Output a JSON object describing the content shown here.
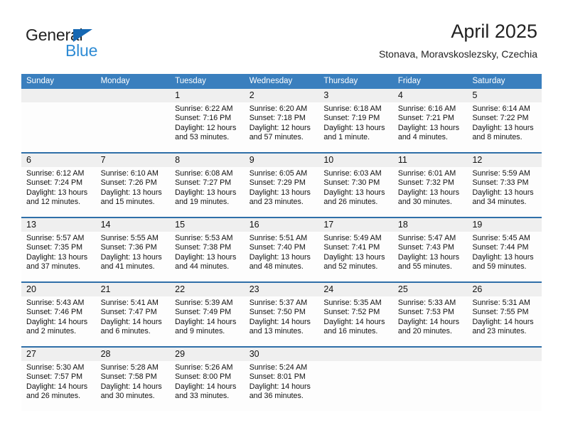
{
  "logo": {
    "word_one": "General",
    "word_two": "Blue",
    "triangle_icon": "triangle-icon",
    "brand_blue": "#2e8bd4",
    "triangle_blue": "#1668b3"
  },
  "header": {
    "title": "April 2025",
    "subtitle": "Stonava, Moravskoslezsky, Czechia"
  },
  "calendar": {
    "header_bg": "#3a7fbe",
    "row_rule": "#2f6fa8",
    "date_band_bg": "#efefef",
    "weekdays": [
      "Sunday",
      "Monday",
      "Tuesday",
      "Wednesday",
      "Thursday",
      "Friday",
      "Saturday"
    ],
    "labels": {
      "sunrise": "Sunrise:",
      "sunset": "Sunset:",
      "daylight": "Daylight:"
    },
    "weeks": [
      [
        {
          "day": "",
          "sunrise": "",
          "sunset": "",
          "daylight": ""
        },
        {
          "day": "",
          "sunrise": "",
          "sunset": "",
          "daylight": ""
        },
        {
          "day": "1",
          "sunrise": "Sunrise: 6:22 AM",
          "sunset": "Sunset: 7:16 PM",
          "daylight": "Daylight: 12 hours and 53 minutes."
        },
        {
          "day": "2",
          "sunrise": "Sunrise: 6:20 AM",
          "sunset": "Sunset: 7:18 PM",
          "daylight": "Daylight: 12 hours and 57 minutes."
        },
        {
          "day": "3",
          "sunrise": "Sunrise: 6:18 AM",
          "sunset": "Sunset: 7:19 PM",
          "daylight": "Daylight: 13 hours and 1 minute."
        },
        {
          "day": "4",
          "sunrise": "Sunrise: 6:16 AM",
          "sunset": "Sunset: 7:21 PM",
          "daylight": "Daylight: 13 hours and 4 minutes."
        },
        {
          "day": "5",
          "sunrise": "Sunrise: 6:14 AM",
          "sunset": "Sunset: 7:22 PM",
          "daylight": "Daylight: 13 hours and 8 minutes."
        }
      ],
      [
        {
          "day": "6",
          "sunrise": "Sunrise: 6:12 AM",
          "sunset": "Sunset: 7:24 PM",
          "daylight": "Daylight: 13 hours and 12 minutes."
        },
        {
          "day": "7",
          "sunrise": "Sunrise: 6:10 AM",
          "sunset": "Sunset: 7:26 PM",
          "daylight": "Daylight: 13 hours and 15 minutes."
        },
        {
          "day": "8",
          "sunrise": "Sunrise: 6:08 AM",
          "sunset": "Sunset: 7:27 PM",
          "daylight": "Daylight: 13 hours and 19 minutes."
        },
        {
          "day": "9",
          "sunrise": "Sunrise: 6:05 AM",
          "sunset": "Sunset: 7:29 PM",
          "daylight": "Daylight: 13 hours and 23 minutes."
        },
        {
          "day": "10",
          "sunrise": "Sunrise: 6:03 AM",
          "sunset": "Sunset: 7:30 PM",
          "daylight": "Daylight: 13 hours and 26 minutes."
        },
        {
          "day": "11",
          "sunrise": "Sunrise: 6:01 AM",
          "sunset": "Sunset: 7:32 PM",
          "daylight": "Daylight: 13 hours and 30 minutes."
        },
        {
          "day": "12",
          "sunrise": "Sunrise: 5:59 AM",
          "sunset": "Sunset: 7:33 PM",
          "daylight": "Daylight: 13 hours and 34 minutes."
        }
      ],
      [
        {
          "day": "13",
          "sunrise": "Sunrise: 5:57 AM",
          "sunset": "Sunset: 7:35 PM",
          "daylight": "Daylight: 13 hours and 37 minutes."
        },
        {
          "day": "14",
          "sunrise": "Sunrise: 5:55 AM",
          "sunset": "Sunset: 7:36 PM",
          "daylight": "Daylight: 13 hours and 41 minutes."
        },
        {
          "day": "15",
          "sunrise": "Sunrise: 5:53 AM",
          "sunset": "Sunset: 7:38 PM",
          "daylight": "Daylight: 13 hours and 44 minutes."
        },
        {
          "day": "16",
          "sunrise": "Sunrise: 5:51 AM",
          "sunset": "Sunset: 7:40 PM",
          "daylight": "Daylight: 13 hours and 48 minutes."
        },
        {
          "day": "17",
          "sunrise": "Sunrise: 5:49 AM",
          "sunset": "Sunset: 7:41 PM",
          "daylight": "Daylight: 13 hours and 52 minutes."
        },
        {
          "day": "18",
          "sunrise": "Sunrise: 5:47 AM",
          "sunset": "Sunset: 7:43 PM",
          "daylight": "Daylight: 13 hours and 55 minutes."
        },
        {
          "day": "19",
          "sunrise": "Sunrise: 5:45 AM",
          "sunset": "Sunset: 7:44 PM",
          "daylight": "Daylight: 13 hours and 59 minutes."
        }
      ],
      [
        {
          "day": "20",
          "sunrise": "Sunrise: 5:43 AM",
          "sunset": "Sunset: 7:46 PM",
          "daylight": "Daylight: 14 hours and 2 minutes."
        },
        {
          "day": "21",
          "sunrise": "Sunrise: 5:41 AM",
          "sunset": "Sunset: 7:47 PM",
          "daylight": "Daylight: 14 hours and 6 minutes."
        },
        {
          "day": "22",
          "sunrise": "Sunrise: 5:39 AM",
          "sunset": "Sunset: 7:49 PM",
          "daylight": "Daylight: 14 hours and 9 minutes."
        },
        {
          "day": "23",
          "sunrise": "Sunrise: 5:37 AM",
          "sunset": "Sunset: 7:50 PM",
          "daylight": "Daylight: 14 hours and 13 minutes."
        },
        {
          "day": "24",
          "sunrise": "Sunrise: 5:35 AM",
          "sunset": "Sunset: 7:52 PM",
          "daylight": "Daylight: 14 hours and 16 minutes."
        },
        {
          "day": "25",
          "sunrise": "Sunrise: 5:33 AM",
          "sunset": "Sunset: 7:53 PM",
          "daylight": "Daylight: 14 hours and 20 minutes."
        },
        {
          "day": "26",
          "sunrise": "Sunrise: 5:31 AM",
          "sunset": "Sunset: 7:55 PM",
          "daylight": "Daylight: 14 hours and 23 minutes."
        }
      ],
      [
        {
          "day": "27",
          "sunrise": "Sunrise: 5:30 AM",
          "sunset": "Sunset: 7:57 PM",
          "daylight": "Daylight: 14 hours and 26 minutes."
        },
        {
          "day": "28",
          "sunrise": "Sunrise: 5:28 AM",
          "sunset": "Sunset: 7:58 PM",
          "daylight": "Daylight: 14 hours and 30 minutes."
        },
        {
          "day": "29",
          "sunrise": "Sunrise: 5:26 AM",
          "sunset": "Sunset: 8:00 PM",
          "daylight": "Daylight: 14 hours and 33 minutes."
        },
        {
          "day": "30",
          "sunrise": "Sunrise: 5:24 AM",
          "sunset": "Sunset: 8:01 PM",
          "daylight": "Daylight: 14 hours and 36 minutes."
        },
        {
          "day": "",
          "sunrise": "",
          "sunset": "",
          "daylight": ""
        },
        {
          "day": "",
          "sunrise": "",
          "sunset": "",
          "daylight": ""
        },
        {
          "day": "",
          "sunrise": "",
          "sunset": "",
          "daylight": ""
        }
      ]
    ]
  }
}
